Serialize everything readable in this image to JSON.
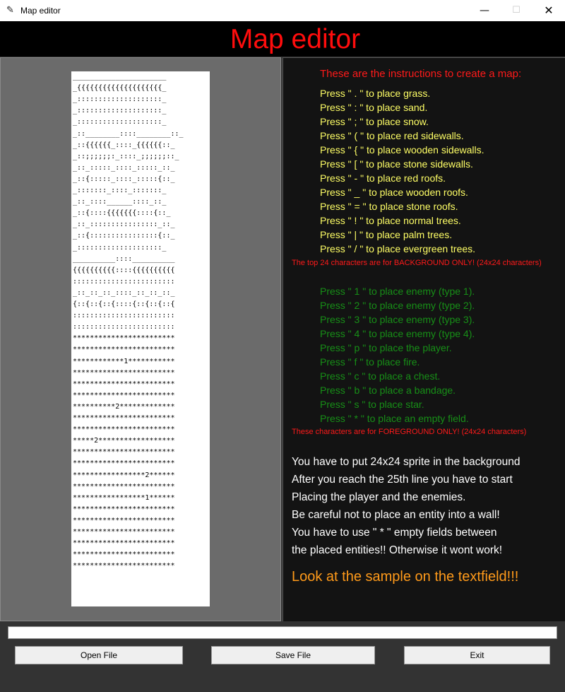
{
  "window": {
    "title": "Map editor",
    "icon": "feather-icon"
  },
  "header": {
    "title": "Map editor"
  },
  "map_lines": [
    "______________________",
    "_{{{{{{{{{{{{{{{{{{{{_",
    "_::::::::::::::::::::_",
    "_::::::::::::::::::::_",
    "_::::::::::::::::::::_",
    "_::________::::________::_",
    "_::{{{{{{_::::_{{{{{{::_",
    "_::;;;;;;:_::::_;;;;;;::_",
    "_::_:::::_::::_:::::_::_",
    "_::{:::::_::::_:::::{::_",
    "_:::::::_::::_:::::::_",
    "_::_::::______::::_::_",
    "_::{::::{{{{{{{::::{::_",
    "_::_::::::::::::::::_::_",
    "_::{::::::::::::::::{::_",
    "_::::::::::::::::::::_",
    "__________::::__________",
    "{{{{{{{{{{::::{{{{{{{{{{",
    "::::::::::::::::::::::::",
    "_::_::_::_::::_::_::_::_",
    "{::{::{::{::::{::{::{::{",
    "::::::::::::::::::::::::",
    "::::::::::::::::::::::::",
    "************************",
    "************************",
    "************1***********",
    "************************",
    "************************",
    "************************",
    "**********2*************",
    "************************",
    "************************",
    "*****2******************",
    "************************",
    "************************",
    "*****************2******",
    "************************",
    "*****************1******",
    "************************",
    "************************",
    "************************",
    "************************",
    "************************",
    "************************"
  ],
  "instructions": {
    "intro": "These are the instructions to create a map:",
    "background": [
      "Press \" . \"  to place grass.",
      "Press \" : \"   to place sand.",
      "Press \" ; \"   to place snow.",
      "Press \" ( \"   to place red sidewalls.",
      "Press \" { \" to place wooden sidewalls.",
      "Press \" [ \"   to place stone sidewalls.",
      "Press \" - \"   to place red roofs.",
      "Press \" _ \"   to place wooden roofs.",
      "Press \" = \"   to place stone roofs.",
      "Press \" ! \"   to place normal trees.",
      "Press \" | \"   to place palm trees.",
      "Press \" / \"   to place evergreen trees."
    ],
    "background_note": "The top 24 characters are for BACKGROUND ONLY! (24x24 characters)",
    "foreground": [
      "Press \" 1 \"  to place enemy (type 1).",
      "Press \" 2 \"  to place enemy (type 2).",
      "Press \" 3 \"  to place enemy (type 3).",
      "Press \" 4 \"  to place enemy (type 4).",
      "Press \" p \"  to place the player.",
      "Press \" f \"  to place fire.",
      "Press \" c \"  to place a chest.",
      "Press \" b \"  to place a bandage.",
      "Press \" s \"  to place star.",
      "Press \" * \"  to place an empty field."
    ],
    "foreground_note": "These characters are for FOREGROUND ONLY! (24x24 characters)",
    "notes": [
      "You have to put 24x24 sprite in the background",
      "After you reach the 25th line you have to start",
      "Placing the player and the enemies.",
      "Be careful not to place an entity into a wall!",
      "You have to use \" * \" empty fields between",
      "the placed entities!! Otherwise it wont work!"
    ],
    "sample_note": "Look at the sample on the textfield!!!"
  },
  "input": {
    "value": ""
  },
  "buttons": {
    "open": "Open File",
    "save": "Save File",
    "exit": "Exit"
  },
  "colors": {
    "title_red": "#ff0d0d",
    "yellow": "#ffff66",
    "green": "#178f17",
    "orange": "#ff9a1a",
    "panel_dark": "#131313",
    "panel_gray": "#6b6b6b"
  }
}
